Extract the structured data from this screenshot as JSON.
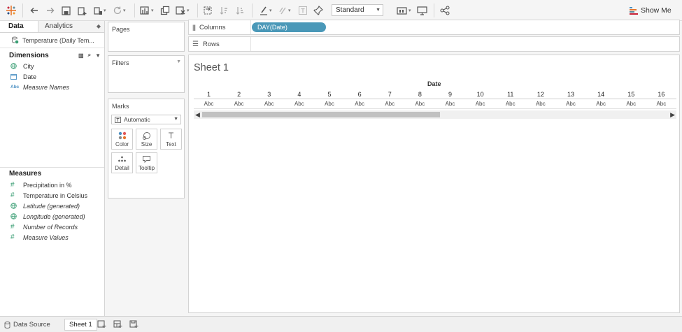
{
  "toolbar": {
    "fit_label": "Standard",
    "show_me_label": "Show Me",
    "icons": [
      "tableau-logo-icon",
      "undo-icon",
      "redo-icon",
      "save-icon",
      "new-datasource-icon",
      "pause-updates-icon",
      "refresh-icon",
      "new-worksheet-icon",
      "duplicate-icon",
      "clear-icon",
      "swap-icon",
      "sort-asc-icon",
      "sort-desc-icon",
      "highlight-icon",
      "group-icon",
      "labels-icon",
      "pin-icon",
      "card-view-icon",
      "presentation-icon",
      "share-icon"
    ]
  },
  "data_pane": {
    "tab_data": "Data",
    "tab_analytics": "Analytics",
    "datasource": "Temperature (Daily Tem...",
    "dimensions_title": "Dimensions",
    "dimensions": [
      {
        "label": "City",
        "icon": "globe-icon",
        "italic": false
      },
      {
        "label": "Date",
        "icon": "calendar-icon",
        "italic": false
      },
      {
        "label": "Measure Names",
        "icon": "abc-icon",
        "italic": true
      }
    ],
    "measures_title": "Measures",
    "measures": [
      {
        "label": "Precipitation in %",
        "icon": "hash-icon",
        "italic": false
      },
      {
        "label": "Temperature in Celsius",
        "icon": "hash-icon",
        "italic": false
      },
      {
        "label": "Latitude (generated)",
        "icon": "globe-icon",
        "italic": true
      },
      {
        "label": "Longitude (generated)",
        "icon": "globe-icon",
        "italic": true
      },
      {
        "label": "Number of Records",
        "icon": "hash-icon",
        "italic": true
      },
      {
        "label": "Measure Values",
        "icon": "hash-icon",
        "italic": true
      }
    ]
  },
  "cards": {
    "pages": "Pages",
    "filters": "Filters",
    "marks": "Marks",
    "mark_type": "Automatic",
    "mark_buttons": [
      "Color",
      "Size",
      "Text",
      "Detail",
      "Tooltip"
    ]
  },
  "shelves": {
    "columns_label": "Columns",
    "rows_label": "Rows",
    "column_pill": "DAY(Date)"
  },
  "view": {
    "sheet_title": "Sheet 1",
    "column_header": "Date",
    "days": [
      "1",
      "2",
      "3",
      "4",
      "5",
      "6",
      "7",
      "8",
      "9",
      "10",
      "11",
      "12",
      "13",
      "14",
      "15",
      "16"
    ],
    "cell_value": "Abc"
  },
  "bottom": {
    "data_source_tab": "Data Source",
    "sheet_tab": "Sheet 1"
  },
  "colors": {
    "pill": "#4a98b8",
    "measure_icon": "#3a9e74",
    "dimension_icon": "#4a8fc2"
  }
}
